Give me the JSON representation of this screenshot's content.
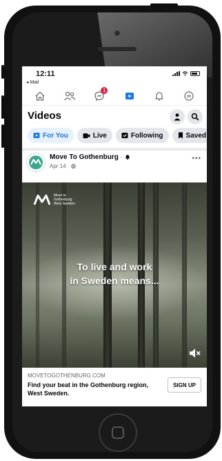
{
  "status_bar": {
    "time": "12:11",
    "back_label": "◂ Mail"
  },
  "nav": {
    "items": [
      {
        "name": "home",
        "active": false
      },
      {
        "name": "friends",
        "active": false
      },
      {
        "name": "messenger",
        "badge": "1",
        "active": false
      },
      {
        "name": "watch",
        "active": true
      },
      {
        "name": "notifications",
        "active": false
      },
      {
        "name": "menu",
        "active": false
      }
    ],
    "accent": "#1877f2"
  },
  "header": {
    "title": "Videos"
  },
  "chips": [
    {
      "label": "For You",
      "active": true,
      "icon": "play-icon"
    },
    {
      "label": "Live",
      "active": false,
      "icon": "live-icon"
    },
    {
      "label": "Following",
      "active": false,
      "icon": "following-icon"
    },
    {
      "label": "Saved",
      "active": false,
      "icon": "bookmark-icon"
    }
  ],
  "post": {
    "page_name": "Move To Gothenburg",
    "date": "Apr 14",
    "more": "•••"
  },
  "video": {
    "logo_text": "Move to Gothenburg West Sweden",
    "caption_line1": "To live and work",
    "caption_line2": "in Sweden means..."
  },
  "ad": {
    "domain": "MOVETOGOTHENBURG.COM",
    "headline": "Find your beat in the Gothenburg region, West Sweden.",
    "cta": "SIGN UP"
  }
}
